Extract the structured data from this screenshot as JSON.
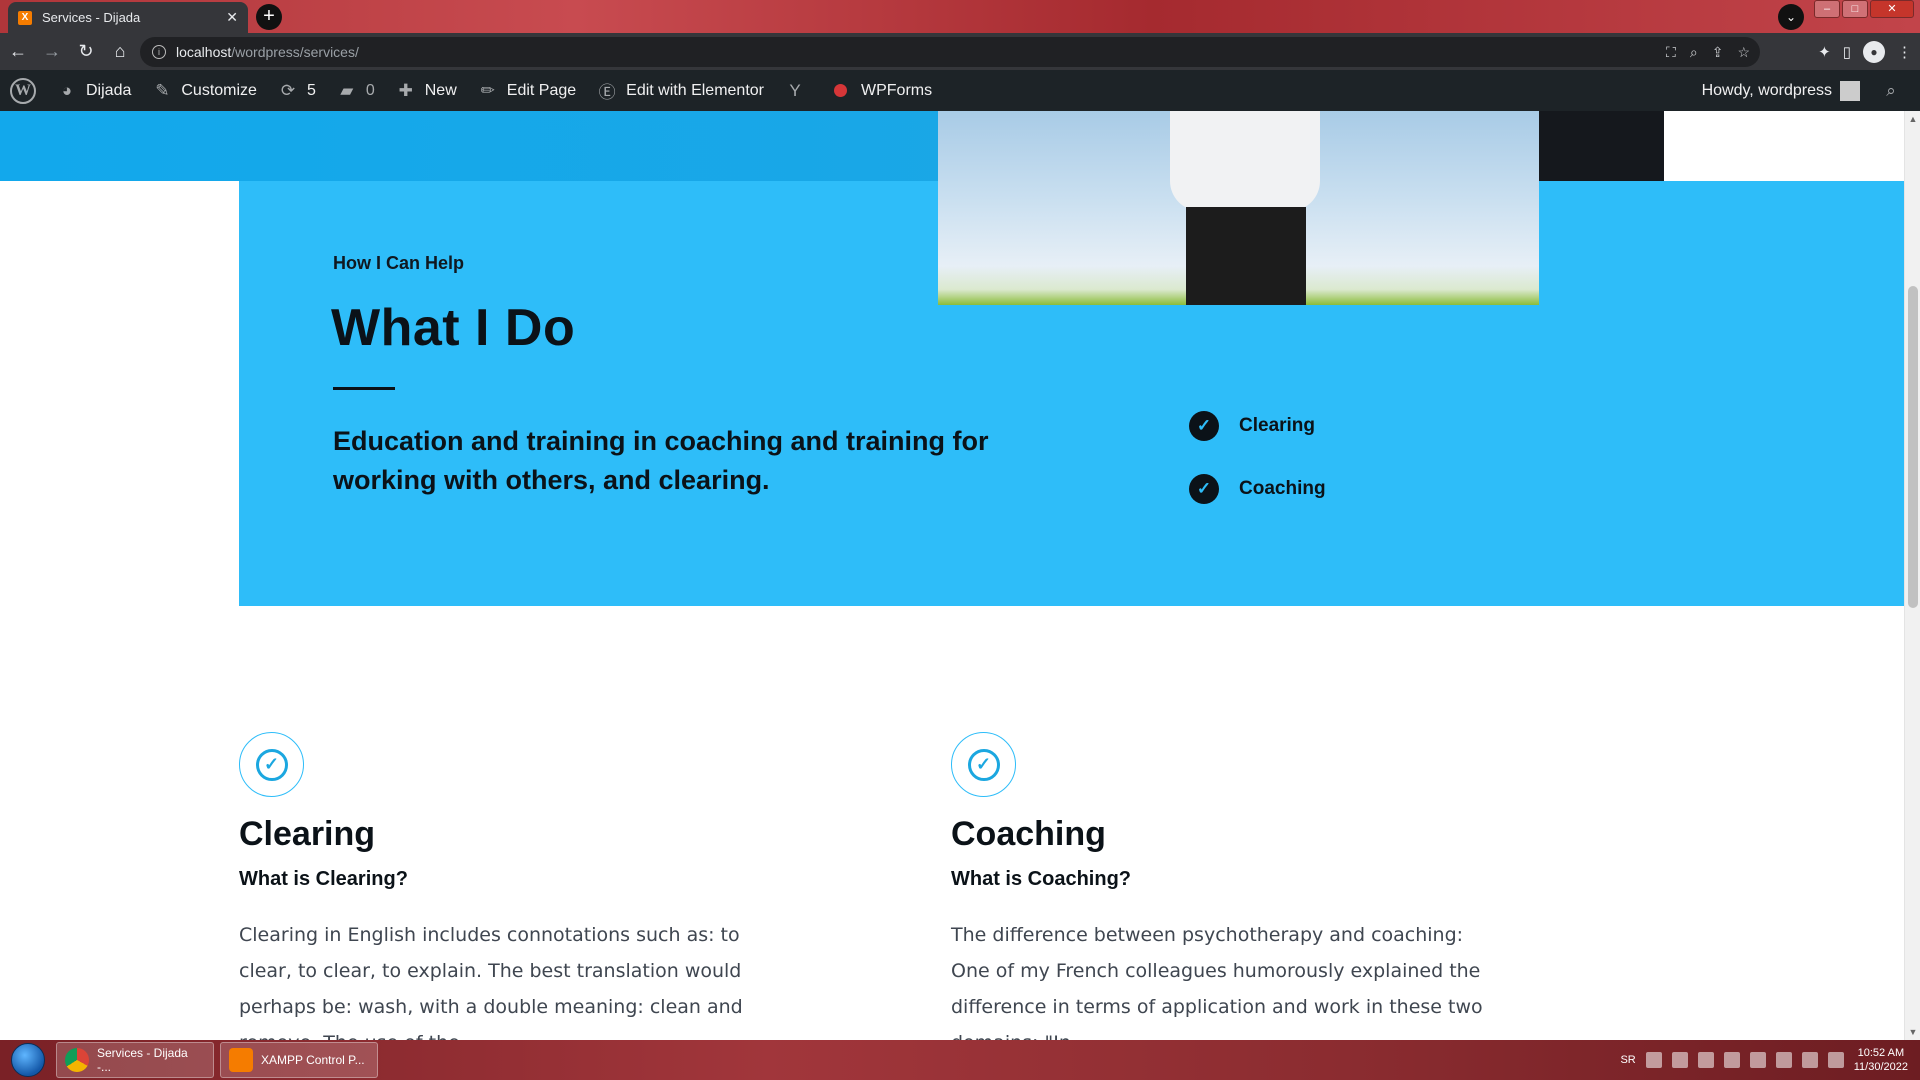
{
  "browser": {
    "tab_title": "Services - Dijada",
    "url_host": "localhost",
    "url_path": "/wordpress/services/"
  },
  "adminbar": {
    "site_name": "Dijada",
    "customize": "Customize",
    "updates_count": "5",
    "comments_count": "0",
    "new": "New",
    "edit_page": "Edit Page",
    "edit_elementor": "Edit with Elementor",
    "wpforms": "WPForms",
    "howdy": "Howdy, wordpress"
  },
  "section": {
    "eyebrow": "How I Can Help",
    "title": "What I Do",
    "lead": "Education and training in coaching and training for working with others, and clearing.",
    "checklist": [
      "Clearing",
      "Coaching"
    ]
  },
  "services": [
    {
      "title": "Clearing",
      "subtitle": "What is Clearing?",
      "body": "Clearing in English includes connotations such as: to clear, to clear, to explain. The best translation would perhaps be: wash, with a double meaning: clean and remove. The use of the"
    },
    {
      "title": "Coaching",
      "subtitle": "What is Coaching?",
      "body": "The difference between psychotherapy and coaching: One of my French colleagues humorously explained the difference in terms of application and work in these two domains: \"In"
    }
  ],
  "taskbar": {
    "chrome_task": "Services - Dijada -...",
    "xampp_task": "XAMPP Control P...",
    "lang": "SR",
    "time": "10:52 AM",
    "date": "11/30/2022"
  },
  "colors": {
    "accent_blue": "#2ebdf9",
    "admin_bar": "#1d2327",
    "dark_text": "#0b1218"
  }
}
